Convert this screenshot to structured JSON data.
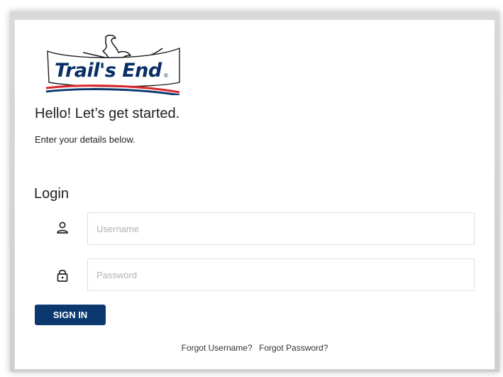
{
  "brand": {
    "logo_text": "Trail's End",
    "registered_mark": "®",
    "accent_blue": "#0c3870",
    "accent_red": "#d9252b"
  },
  "greeting": {
    "heading": "Hello! Let’s get started.",
    "subtext": "Enter your details below."
  },
  "login": {
    "title": "Login",
    "username_placeholder": "Username",
    "password_placeholder": "Password",
    "username_icon": "user-icon",
    "password_icon": "lock-icon",
    "sign_in_label": "SIGN IN"
  },
  "footer_links": {
    "forgot_username": "Forgot Username?",
    "forgot_password": "Forgot Password?"
  }
}
